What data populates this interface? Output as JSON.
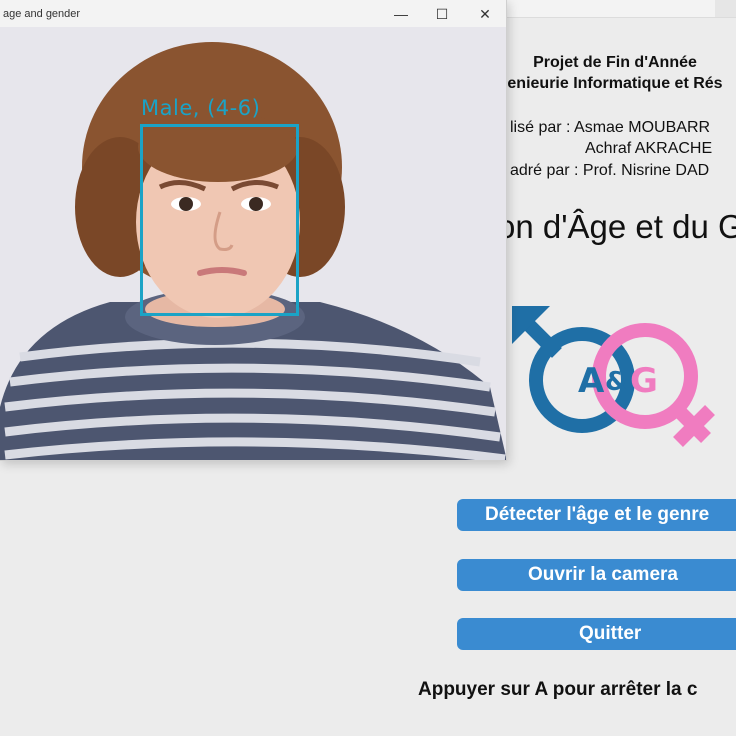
{
  "app": {
    "header_line1": "Projet de Fin d'Année",
    "header_line2": "enieurie Informatique et Rés",
    "credit_line1": "lisé par : Asmae MOUBARR",
    "credit_line2": "Achraf AKRACHE",
    "credit_line3": "adré par : Prof. Nisrine DAD",
    "main_title": "on d'Âge et du G",
    "logo_text": {
      "left": "A",
      "amp": "&",
      "right": "G"
    },
    "buttons": {
      "detect": "Détecter l'âge et le genre",
      "camera": "Ouvrir la camera",
      "quit": "Quitter"
    },
    "hint": "Appuyer sur A pour arrêter la c"
  },
  "cv_window": {
    "title": "age and gender",
    "controls": {
      "minimize": "—",
      "maximize": "☐",
      "close": "✕"
    },
    "detection": {
      "label": "Male, (4-6)"
    }
  },
  "colors": {
    "button": "#3a8bd1",
    "detection": "#1ba3c6",
    "logo_blue": "#1f6fa6",
    "logo_pink": "#f07cc0"
  }
}
